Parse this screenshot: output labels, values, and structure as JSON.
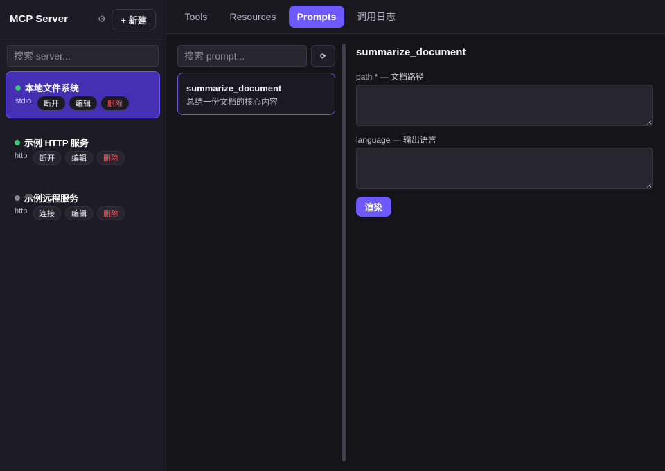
{
  "sidebar": {
    "title": "MCP Server",
    "settings_icon": "gear-icon",
    "new_label": "+ 新建",
    "search_placeholder": "搜索 server...",
    "servers": [
      {
        "name": "本地文件系统",
        "type": "stdio",
        "status": "connected",
        "active": true,
        "actions": [
          "断开",
          "编辑",
          "删除"
        ]
      },
      {
        "name": "示例 HTTP 服务",
        "type": "http",
        "status": "connected",
        "active": false,
        "actions": [
          "断开",
          "编辑",
          "删除"
        ]
      },
      {
        "name": "示例远程服务",
        "type": "http",
        "status": "disconnected",
        "active": false,
        "actions": [
          "连接",
          "编辑",
          "删除"
        ]
      }
    ]
  },
  "tabs": [
    {
      "label": "Tools",
      "active": false
    },
    {
      "label": "Resources",
      "active": false
    },
    {
      "label": "Prompts",
      "active": true
    },
    {
      "label": "调用日志",
      "active": false
    }
  ],
  "prompts": {
    "search_placeholder": "搜索 prompt...",
    "refresh_icon": "⟳",
    "items": [
      {
        "name": "summarize_document",
        "description": "总结一份文档的核心内容"
      }
    ]
  },
  "detail": {
    "title": "summarize_document",
    "fields": [
      {
        "label": "path * — 文档路径",
        "value": ""
      },
      {
        "label": "language — 输出语言",
        "value": ""
      }
    ],
    "render_label": "渲染"
  },
  "colors": {
    "accent": "#6e59ff",
    "active_server_bg": "#4530b4",
    "status_on": "#3ec77a",
    "status_off": "#8a8990",
    "danger": "#ff5a5f"
  }
}
